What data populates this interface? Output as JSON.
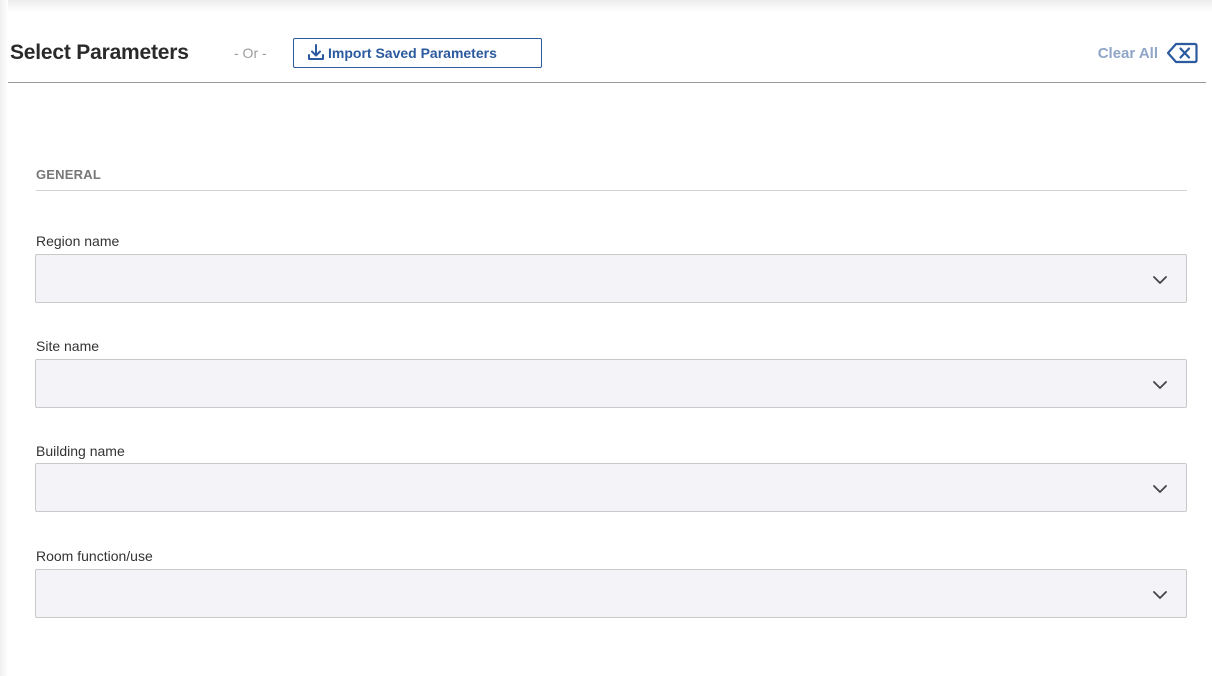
{
  "header": {
    "title": "Select Parameters",
    "or_separator": "- Or -",
    "import_label": "Import Saved Parameters",
    "clear_all_label": "Clear All"
  },
  "section": {
    "title": "GENERAL"
  },
  "fields": [
    {
      "label": "Region name",
      "value": ""
    },
    {
      "label": "Site name",
      "value": ""
    },
    {
      "label": "Building name",
      "value": ""
    },
    {
      "label": "Room function/use",
      "value": ""
    }
  ],
  "colors": {
    "accent": "#2c5a9e",
    "clear_all": "#8fa6c6",
    "select_bg": "#f4f4f8"
  },
  "icons": {
    "import": "download-icon",
    "clear": "backspace-clear-icon",
    "dropdown": "chevron-down-icon"
  }
}
